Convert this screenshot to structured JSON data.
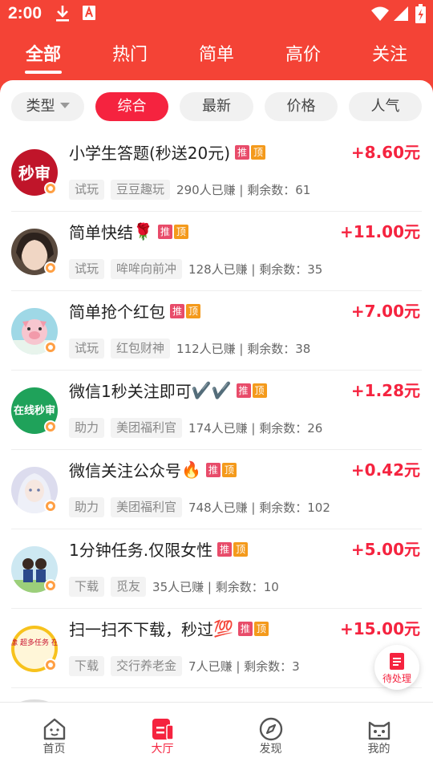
{
  "status_bar": {
    "time": "2:00",
    "icons": [
      "download-icon",
      "font-app-icon",
      "wifi-icon",
      "signal-icon",
      "battery-icon"
    ]
  },
  "top_tabs": [
    {
      "label": "全部",
      "active": true
    },
    {
      "label": "热门",
      "active": false
    },
    {
      "label": "简单",
      "active": false
    },
    {
      "label": "高价",
      "active": false
    },
    {
      "label": "关注",
      "active": false
    }
  ],
  "filters": [
    {
      "label": "类型",
      "dropdown": true,
      "active": false
    },
    {
      "label": "综合",
      "active": true
    },
    {
      "label": "最新",
      "active": false
    },
    {
      "label": "价格",
      "active": false
    },
    {
      "label": "人气",
      "active": false
    }
  ],
  "badges": {
    "recommend": "推",
    "top": "顶"
  },
  "tasks": [
    {
      "title": "小学生答题(秒送20元)",
      "emoji": "",
      "price": "+8.60元",
      "type_tag": "试玩",
      "publisher": "豆豆趣玩",
      "stats": "290人已赚 | 剩余数：61",
      "avatar": {
        "name": "秒审",
        "bg": "#c0152a"
      }
    },
    {
      "title": "简单快结",
      "emoji": "🌹",
      "price": "+11.00元",
      "type_tag": "试玩",
      "publisher": "哞哞向前冲",
      "stats": "128人已赚 | 剩余数：35",
      "avatar": {
        "name": "",
        "bg": "#5a4a3e"
      }
    },
    {
      "title": "简单抢个红包",
      "emoji": "",
      "price": "+7.00元",
      "type_tag": "试玩",
      "publisher": "红包财神",
      "stats": "112人已赚 | 剩余数：38",
      "avatar": {
        "name": "",
        "bg": "#9fd8e6"
      }
    },
    {
      "title": "微信1秒关注即可",
      "emoji": "✔️✔️",
      "price": "+1.28元",
      "type_tag": "助力",
      "publisher": "美团福利官",
      "stats": "174人已赚 | 剩余数：26",
      "avatar": {
        "name": "在线秒审",
        "bg": "#1fa25a"
      }
    },
    {
      "title": "微信关注公众号",
      "emoji": "🔥",
      "price": "+0.42元",
      "type_tag": "助力",
      "publisher": "美团福利官",
      "stats": "748人已赚 | 剩余数：102",
      "avatar": {
        "name": "",
        "bg": "#dcdcee"
      }
    },
    {
      "title": "1分钟任务.仅限女性",
      "emoji": "",
      "price": "+5.00元",
      "type_tag": "下载",
      "publisher": "觅友",
      "stats": "35人已赚 | 剩余数：10",
      "avatar": {
        "name": "",
        "bg": "#cde8f2"
      }
    },
    {
      "title": "扫一扫不下载，秒过",
      "emoji": "💯",
      "price": "+15.00元",
      "type_tag": "下载",
      "publisher": "交行养老金",
      "stats": "7人已赚 | 剩余数：3",
      "avatar": {
        "name": "点击头像 超多任务 在线秒审",
        "bg": "#f7c21d"
      }
    }
  ],
  "fab": {
    "label": "待处理",
    "icon": "clipboard-icon"
  },
  "bottom_nav": [
    {
      "label": "首页",
      "icon": "home-face-icon",
      "active": false
    },
    {
      "label": "大厅",
      "icon": "hall-icon",
      "active": true
    },
    {
      "label": "发现",
      "icon": "compass-icon",
      "active": false
    },
    {
      "label": "我的",
      "icon": "cat-face-icon",
      "active": false
    }
  ],
  "colors": {
    "brand": "#f44336",
    "accent": "#f5233f",
    "badge_recommend": "#e84c6a",
    "badge_top": "#f49a1c"
  }
}
